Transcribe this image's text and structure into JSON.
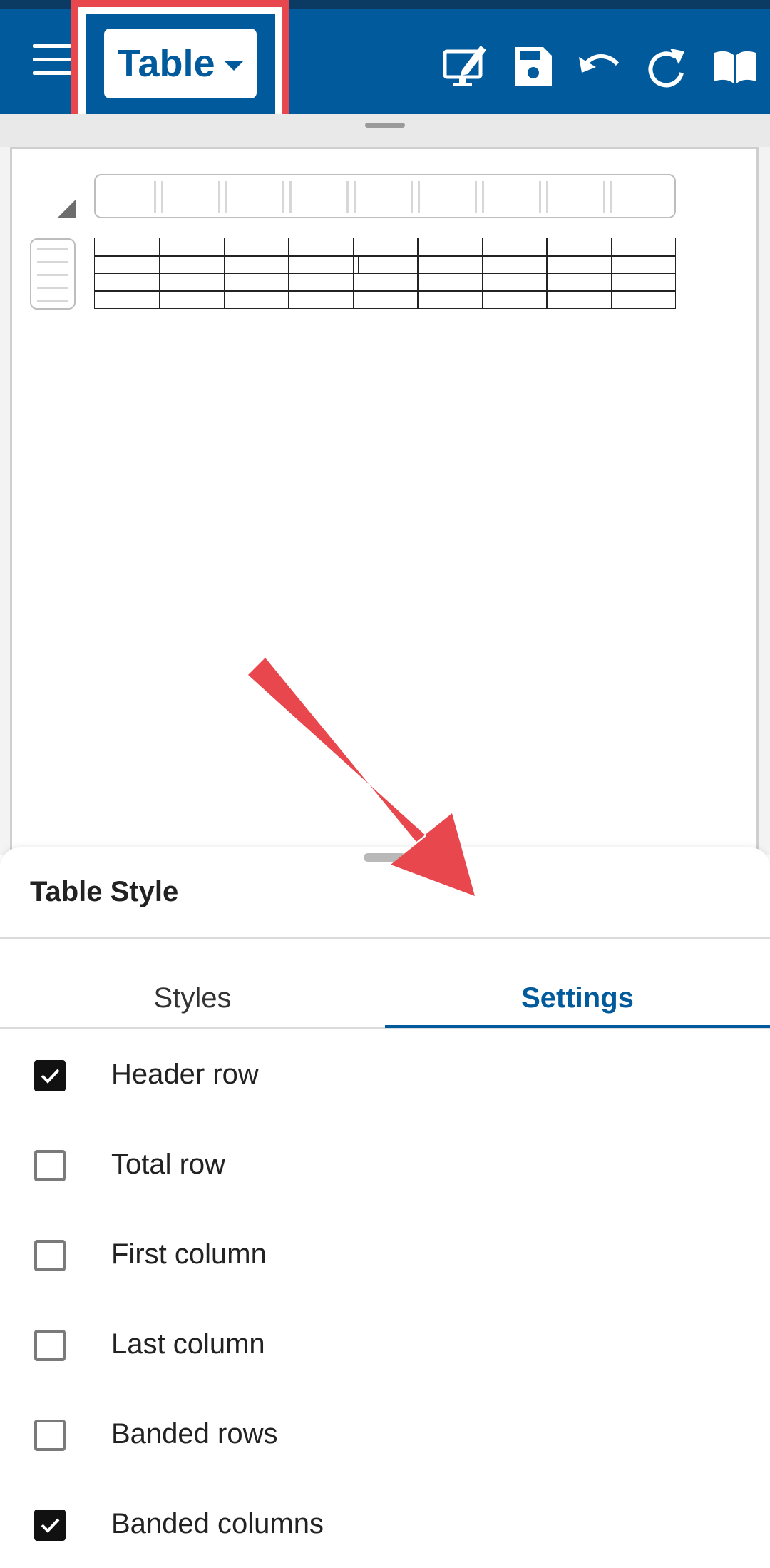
{
  "toolbar": {
    "title": "Table",
    "icons": [
      "menu-icon",
      "monitor-edit-icon",
      "save-icon",
      "undo-icon",
      "redo-icon",
      "book-icon"
    ]
  },
  "bottom_sheet": {
    "title": "Table Style",
    "tabs": [
      {
        "label": "Styles",
        "active": false
      },
      {
        "label": "Settings",
        "active": true
      }
    ],
    "options": [
      {
        "label": "Header row",
        "checked": true
      },
      {
        "label": "Total row",
        "checked": false
      },
      {
        "label": "First column",
        "checked": false
      },
      {
        "label": "Last column",
        "checked": false
      },
      {
        "label": "Banded rows",
        "checked": false
      },
      {
        "label": "Banded columns",
        "checked": true
      }
    ]
  },
  "colors": {
    "toolbar": "#005a9c",
    "accent": "#005a9c",
    "highlight": "#e8474d"
  }
}
